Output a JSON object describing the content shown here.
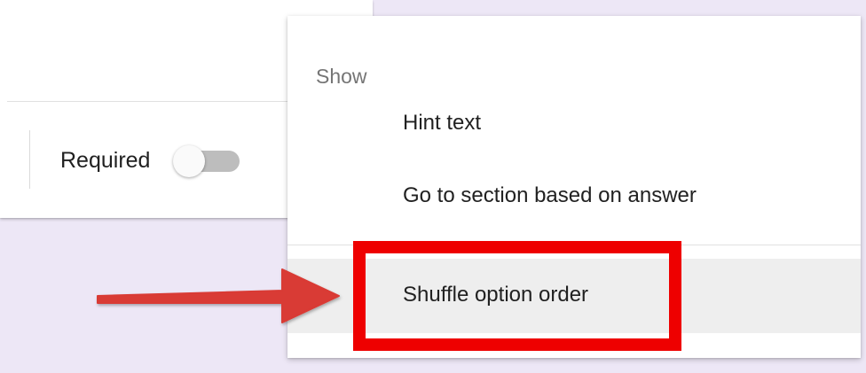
{
  "form": {
    "required_label": "Required",
    "required_toggle_on": false
  },
  "menu": {
    "section_header": "Show",
    "items": [
      {
        "label": "Hint text"
      },
      {
        "label": "Go to section based on answer"
      },
      {
        "label": "Shuffle option order",
        "highlighted": true
      }
    ]
  },
  "annotation": {
    "arrow_color": "#d93a34",
    "highlight_box_color": "#ee0000"
  },
  "colors": {
    "background": "#ede7f6",
    "menu_highlight_row": "#eeeeee",
    "toggle_off_track": "#bdbdbd"
  }
}
